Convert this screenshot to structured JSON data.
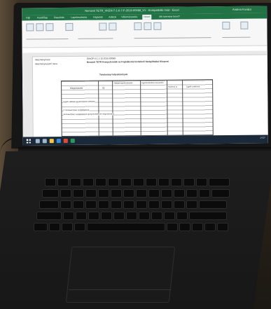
{
  "window": {
    "title": "Nemzeti TETR_VKEN-T-1-6-7-F-2016-00068_V1 - Kompatibilis mód - Excel",
    "user": "Andrea Kovács"
  },
  "ribbon": {
    "tabs": [
      "Fájl",
      "Kezdőlap",
      "Beszúrás",
      "Lapelrendezés",
      "Képletek",
      "Adatok",
      "Véleményezés",
      "Nézet",
      "Mit szeretne tenni?"
    ],
    "active_tab": "Nézet"
  },
  "sheet": {
    "row_labels": [
      "Intézményneve:",
      "Intézményvezető neve:"
    ],
    "header_line_1": "GINOP-5.1.1-15-2016-00068",
    "header_line_2": "Nemzeti TETR Kompetenciák és Foglalkozás kivitelező Szolgáltatási Központ",
    "table_caption": "Tanulmányi teljesítmények",
    "col_headers": [
      "Megnevezés",
      "Új",
      "Vállalati együttműködés",
      "Együttműködési összesítés",
      "Szakmai út",
      "Egyéb szektorok"
    ],
    "row_items": [
      "Egyéb vállalati együttműködés kifejtése",
      "3. Munkaerőpiaci szolgáltatások",
      "Munkaerőpiaci szolgáltatások igénybevételének megvalósítása"
    ]
  },
  "taskbar": {
    "clock": "14:27"
  }
}
